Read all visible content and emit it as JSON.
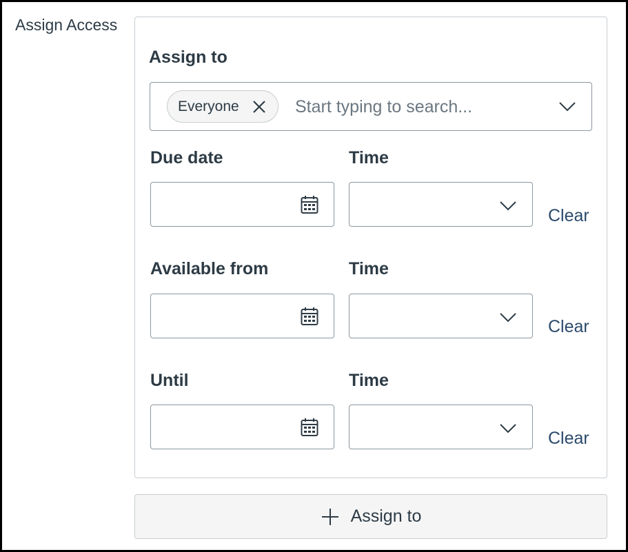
{
  "section": {
    "label": "Assign Access"
  },
  "assign": {
    "heading": "Assign to",
    "chip": {
      "label": "Everyone",
      "icon": "close-icon"
    },
    "search": {
      "placeholder": "Start typing to search...",
      "value": "",
      "icon": "chevron-down-icon"
    }
  },
  "rows": [
    {
      "date_label": "Due date",
      "time_label": "Time",
      "date_value": "",
      "time_value": "",
      "clear_label": "Clear"
    },
    {
      "date_label": "Available from",
      "time_label": "Time",
      "date_value": "",
      "time_value": "",
      "clear_label": "Clear"
    },
    {
      "date_label": "Until",
      "time_label": "Time",
      "date_value": "",
      "time_value": "",
      "clear_label": "Clear"
    }
  ],
  "footer": {
    "add_label": "Assign to",
    "icon": "plus-icon"
  },
  "colors": {
    "text": "#2d3b45",
    "link": "#2b4a6b",
    "border": "#8b969e",
    "chip_bg": "#f5f5f5",
    "frame": "#000000"
  }
}
